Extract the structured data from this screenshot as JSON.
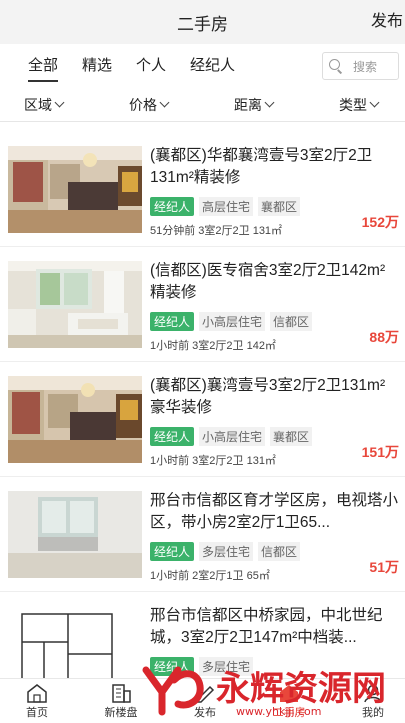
{
  "header": {
    "title": "二手房",
    "publish": "发布"
  },
  "tabs": [
    {
      "label": "全部"
    },
    {
      "label": "精选"
    },
    {
      "label": "个人"
    },
    {
      "label": "经纪人"
    }
  ],
  "search": {
    "placeholder": "搜索"
  },
  "filters": [
    {
      "label": "区域"
    },
    {
      "label": "价格"
    },
    {
      "label": "距离"
    },
    {
      "label": "类型"
    }
  ],
  "listings": [
    {
      "title": "(襄都区)华都襄湾壹号3室2厅2卫131m²精装修",
      "agent": "经纪人",
      "type": "高层住宅",
      "district": "襄都区",
      "meta": "51分钟前 3室2厅2卫 131㎡",
      "price": "152万"
    },
    {
      "title": "(信都区)医专宿舍3室2厅2卫142m²精装修",
      "agent": "经纪人",
      "type": "小高层住宅",
      "district": "信都区",
      "meta": "1小时前 3室2厅2卫 142㎡",
      "price": "88万"
    },
    {
      "title": "(襄都区)襄湾壹号3室2厅2卫131m²豪华装修",
      "agent": "经纪人",
      "type": "小高层住宅",
      "district": "襄都区",
      "meta": "1小时前 3室2厅2卫 131㎡",
      "price": "151万"
    },
    {
      "title": "邢台市信都区育才学区房，电视塔小区，带小房2室2厅1卫65...",
      "agent": "经纪人",
      "type": "多层住宅",
      "district": "信都区",
      "meta": "1小时前 2室2厅1卫 65㎡",
      "price": "51万"
    },
    {
      "title": "邢台市信都区中桥家园，中北世纪城，3室2厅2卫147m²中档装...",
      "agent": "经纪人",
      "type": "多层住宅",
      "district": "",
      "meta": "",
      "price": ""
    }
  ],
  "tabbar": [
    {
      "label": "首页"
    },
    {
      "label": "新楼盘"
    },
    {
      "label": "发布"
    },
    {
      "label": "二手房"
    },
    {
      "label": "我的"
    }
  ],
  "watermark": {
    "text": "永辉资源网",
    "url": "www.yhkjjj.com"
  },
  "colors": {
    "accent_green": "#3bb26a",
    "price_red": "#e8473b",
    "watermark_red": "#d9262c"
  }
}
